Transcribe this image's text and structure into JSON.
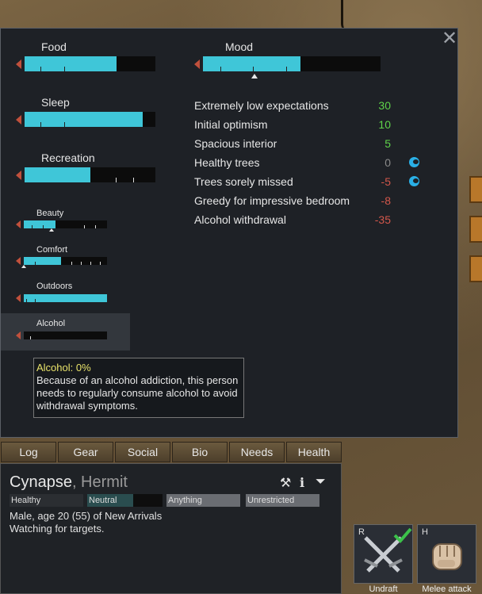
{
  "needs": {
    "food": {
      "label": "Food",
      "level": 0.7
    },
    "sleep": {
      "label": "Sleep",
      "level": 0.9
    },
    "recreation": {
      "label": "Recreation",
      "level": 0.5
    },
    "mood": {
      "label": "Mood",
      "level": 0.55
    },
    "beauty": {
      "label": "Beauty",
      "level": 0.38
    },
    "comfort": {
      "label": "Comfort",
      "level": 0.45
    },
    "outdoors": {
      "label": "Outdoors",
      "level": 1.0
    },
    "alcohol": {
      "label": "Alcohol",
      "level": 0.0
    }
  },
  "thoughts": [
    {
      "text": "Extremely low expectations",
      "value": "30",
      "sign": "pos",
      "icon": ""
    },
    {
      "text": "Initial optimism",
      "value": "10",
      "sign": "pos",
      "icon": ""
    },
    {
      "text": "Spacious interior",
      "value": "5",
      "sign": "pos",
      "icon": ""
    },
    {
      "text": "Healthy trees",
      "value": "0",
      "sign": "zero",
      "icon": "ideology-icon"
    },
    {
      "text": "Trees sorely missed",
      "value": "-5",
      "sign": "neg",
      "icon": "ideology-icon"
    },
    {
      "text": "Greedy for impressive bedroom",
      "value": "-8",
      "sign": "neg",
      "icon": ""
    },
    {
      "text": "Alcohol withdrawal",
      "value": "-35",
      "sign": "neg",
      "icon": ""
    }
  ],
  "tooltip": {
    "title": "Alcohol: 0%",
    "body": "Because of an alcohol addiction, this person needs to regularly consume alcohol to avoid withdrawal symptoms."
  },
  "tabs": [
    "Log",
    "Gear",
    "Social",
    "Bio",
    "Needs",
    "Health"
  ],
  "pawn": {
    "name": "Cynapse",
    "title": ", Hermit",
    "chips": [
      "Healthy",
      "Neutral",
      "Anything",
      "Unrestricted"
    ],
    "line1": "Male, age 20 (55) of New Arrivals",
    "line2": "Watching for targets."
  },
  "commands": [
    {
      "key": "R",
      "label": "Undraft"
    },
    {
      "key": "H",
      "label": "Melee attack"
    }
  ],
  "colors": {
    "bar_fill": "#3fc6d8",
    "positive": "#5fd34a",
    "negative": "#d2574b",
    "tooltip_title": "#e8e26a"
  }
}
